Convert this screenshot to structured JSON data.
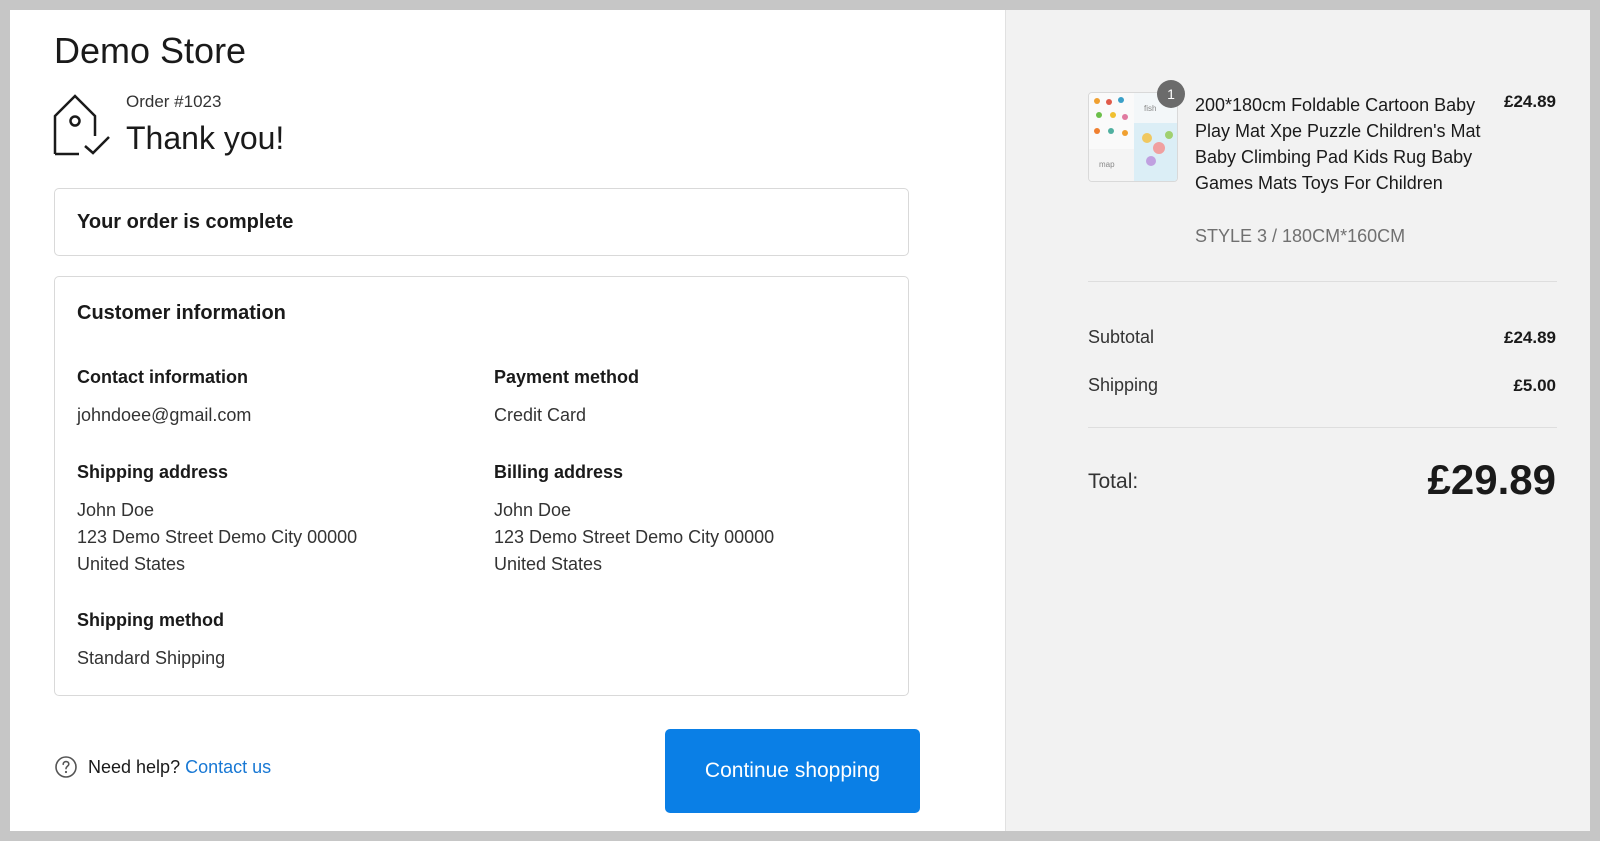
{
  "store": {
    "name": "Demo Store"
  },
  "header": {
    "order_number": "Order #1023",
    "thanks": "Thank you!"
  },
  "status_card": {
    "title": "Your order is complete"
  },
  "customer": {
    "title": "Customer information",
    "contact": {
      "label": "Contact information",
      "email": "johndoee@gmail.com"
    },
    "payment": {
      "label": "Payment method",
      "value": "Credit Card"
    },
    "shipping_address": {
      "label": "Shipping address",
      "lines": [
        "John Doe",
        "123 Demo Street Demo City 00000",
        "United States"
      ]
    },
    "billing_address": {
      "label": "Billing address",
      "lines": [
        "John Doe",
        "123 Demo Street Demo City 00000",
        "United States"
      ]
    },
    "shipping_method": {
      "label": "Shipping method",
      "value": "Standard Shipping"
    }
  },
  "footer": {
    "help_text": "Need help?",
    "contact_link": "Contact us",
    "continue_label": "Continue shopping"
  },
  "summary": {
    "item": {
      "quantity": "1",
      "title": "200*180cm Foldable Cartoon Baby Play Mat Xpe Puzzle Children's Mat Baby Climbing Pad Kids Rug Baby Games Mats Toys For Children",
      "variant": "STYLE 3 / 180CM*160CM",
      "price": "£24.89",
      "thumb_text_fish": "fish",
      "thumb_text_map": "map"
    },
    "subtotal_label": "Subtotal",
    "subtotal": "£24.89",
    "shipping_label": "Shipping",
    "shipping": "£5.00",
    "total_label": "Total:",
    "total": "£29.89"
  },
  "colors": {
    "accent": "#0a7fe6",
    "link": "#1878d4",
    "sidebar_bg": "#f2f2f2",
    "badge": "#6b6b6b"
  },
  "icons": [
    "tag-check-icon",
    "help-circle-icon"
  ]
}
